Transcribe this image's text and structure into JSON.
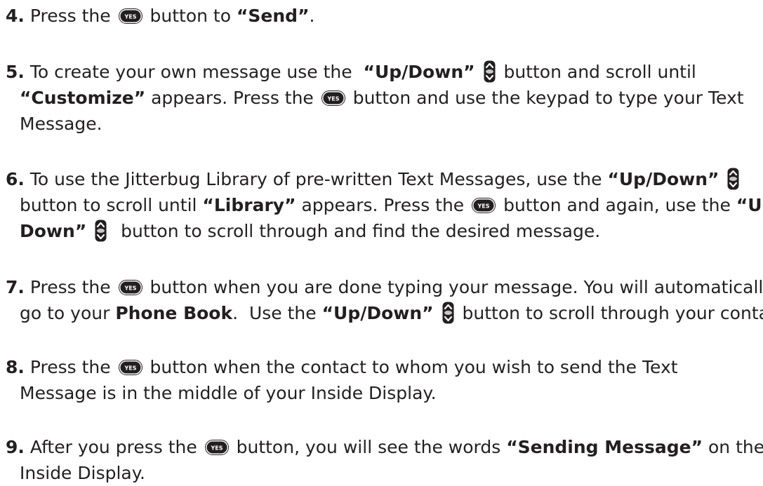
{
  "icons": {
    "yes": "yes-button-icon",
    "updown": "up-down-button-icon"
  },
  "icon_labels": {
    "yes": "YES"
  },
  "steps": [
    {
      "num": "4.",
      "lines": [
        {
          "segments": [
            {
              "t": "text",
              "v": " Press the "
            },
            {
              "t": "icon",
              "v": "yes"
            },
            {
              "t": "text",
              "v": " button to "
            },
            {
              "t": "bold",
              "v": "“Send”"
            },
            {
              "t": "text",
              "v": "."
            }
          ]
        }
      ]
    },
    {
      "num": "5.",
      "lines": [
        {
          "segments": [
            {
              "t": "text",
              "v": " To create your own message use the  "
            },
            {
              "t": "bold",
              "v": "“Up/Down”"
            },
            {
              "t": "text",
              "v": " "
            },
            {
              "t": "icon",
              "v": "updown"
            },
            {
              "t": "text",
              "v": " button and scroll until"
            }
          ]
        },
        {
          "segments": [
            {
              "t": "bold",
              "v": "“Customize”"
            },
            {
              "t": "text",
              "v": " appears. Press the "
            },
            {
              "t": "icon",
              "v": "yes"
            },
            {
              "t": "text",
              "v": " button and use the keypad to type your Text"
            }
          ]
        },
        {
          "segments": [
            {
              "t": "text",
              "v": "Message."
            }
          ]
        }
      ]
    },
    {
      "num": "6.",
      "lines": [
        {
          "segments": [
            {
              "t": "text",
              "v": " To use the Jitterbug Library of pre-written Text Messages, use the "
            },
            {
              "t": "bold",
              "v": "“Up/Down”"
            },
            {
              "t": "text",
              "v": " "
            },
            {
              "t": "icon",
              "v": "updown"
            }
          ]
        },
        {
          "segments": [
            {
              "t": "text",
              "v": "button to scroll until "
            },
            {
              "t": "bold",
              "v": "“Library”"
            },
            {
              "t": "text",
              "v": " appears. Press the "
            },
            {
              "t": "icon",
              "v": "yes"
            },
            {
              "t": "text",
              "v": " button and again, use the "
            },
            {
              "t": "bold",
              "v": "“Up/"
            }
          ]
        },
        {
          "segments": [
            {
              "t": "bold",
              "v": "Down”"
            },
            {
              "t": "text",
              "v": " "
            },
            {
              "t": "icon",
              "v": "updown"
            },
            {
              "t": "text",
              "v": "  button to scroll through and find the desired message."
            }
          ]
        }
      ]
    },
    {
      "num": "7.",
      "lines": [
        {
          "segments": [
            {
              "t": "text",
              "v": " Press the "
            },
            {
              "t": "icon",
              "v": "yes"
            },
            {
              "t": "text",
              "v": " button when you are done typing your message. You will automatically"
            }
          ]
        },
        {
          "segments": [
            {
              "t": "text",
              "v": "go to your "
            },
            {
              "t": "bold",
              "v": "Phone Book"
            },
            {
              "t": "text",
              "v": ".  Use the "
            },
            {
              "t": "bold",
              "v": "“Up/Down”"
            },
            {
              "t": "text",
              "v": " "
            },
            {
              "t": "icon",
              "v": "updown"
            },
            {
              "t": "text",
              "v": " button to scroll through your contacts."
            }
          ]
        }
      ]
    },
    {
      "num": "8.",
      "lines": [
        {
          "segments": [
            {
              "t": "text",
              "v": " Press the "
            },
            {
              "t": "icon",
              "v": "yes"
            },
            {
              "t": "text",
              "v": " button when the contact to whom you wish to send the Text"
            }
          ]
        },
        {
          "segments": [
            {
              "t": "text",
              "v": "Message is in the middle of your Inside Display."
            }
          ]
        }
      ]
    },
    {
      "num": "9.",
      "lines": [
        {
          "segments": [
            {
              "t": "text",
              "v": " After you press the "
            },
            {
              "t": "icon",
              "v": "yes"
            },
            {
              "t": "text",
              "v": " button, you will see the words "
            },
            {
              "t": "bold",
              "v": "“Sending Message”"
            },
            {
              "t": "text",
              "v": " on the"
            }
          ]
        },
        {
          "segments": [
            {
              "t": "text",
              "v": "Inside Display."
            }
          ]
        }
      ]
    }
  ]
}
